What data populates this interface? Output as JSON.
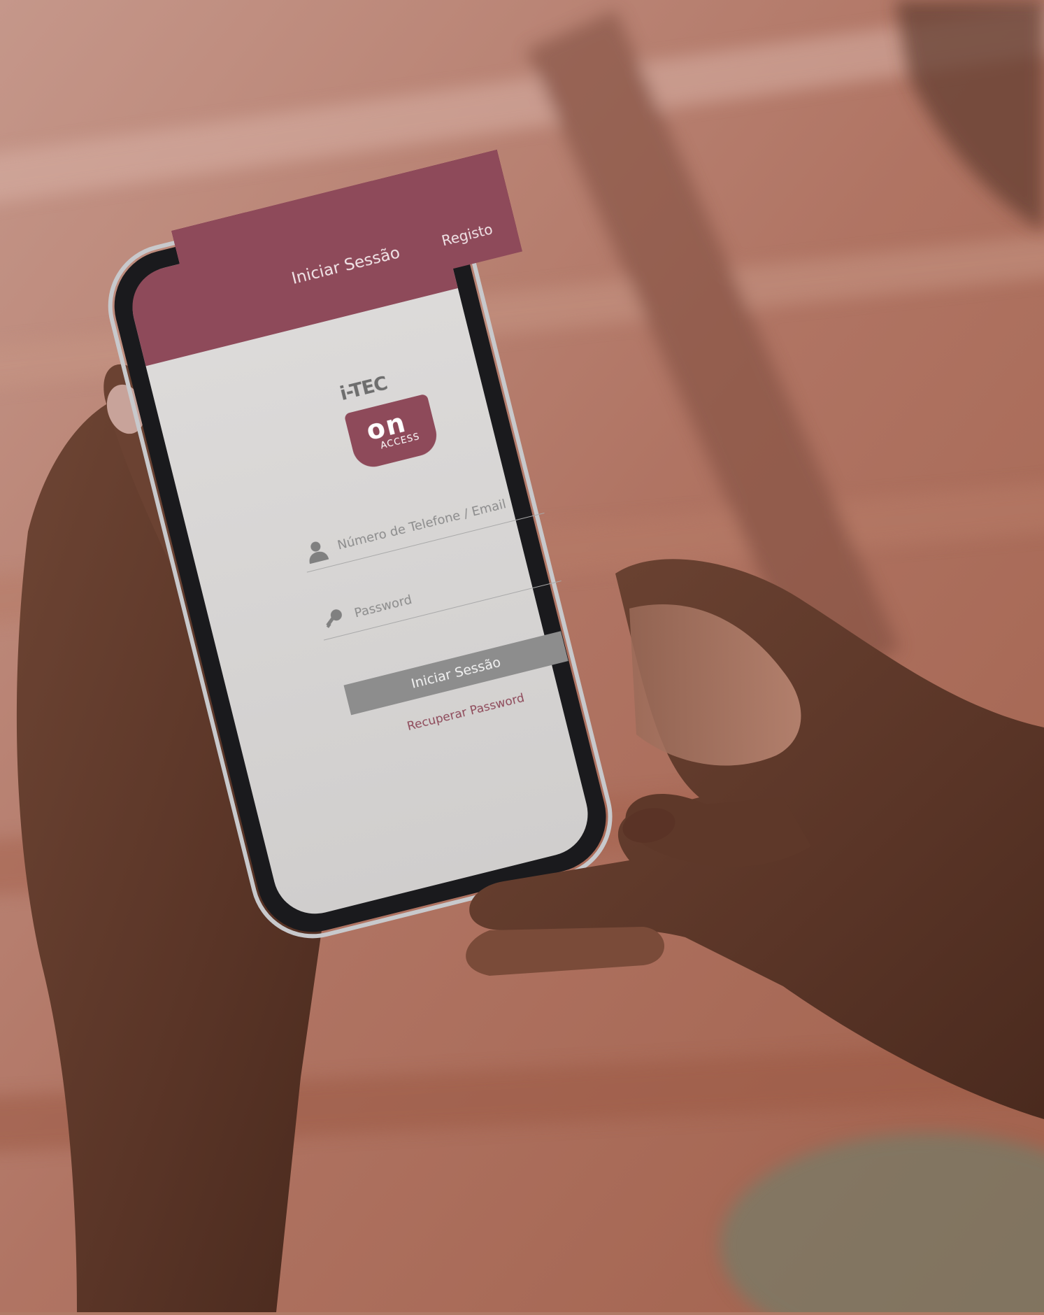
{
  "app": {
    "header": {
      "title": "Iniciar Sessão",
      "register_link": "Registo"
    },
    "logo": {
      "brand": "i-TEC",
      "badge_word": "on",
      "badge_sub": "ACCESS"
    },
    "form": {
      "phone_placeholder": "Número de Telefone / Email",
      "password_placeholder": "Password",
      "submit_label": "Iniciar Sessão",
      "recover_link": "Recuperar Password"
    }
  },
  "colors": {
    "brand_accent": "#8e4a5a",
    "screen_bg": "#d9d7d6",
    "button_bg": "#8d8d8d",
    "background_blur": "#b07a66"
  },
  "icons": {
    "phone_field": "user-icon",
    "password_field": "key-icon"
  }
}
